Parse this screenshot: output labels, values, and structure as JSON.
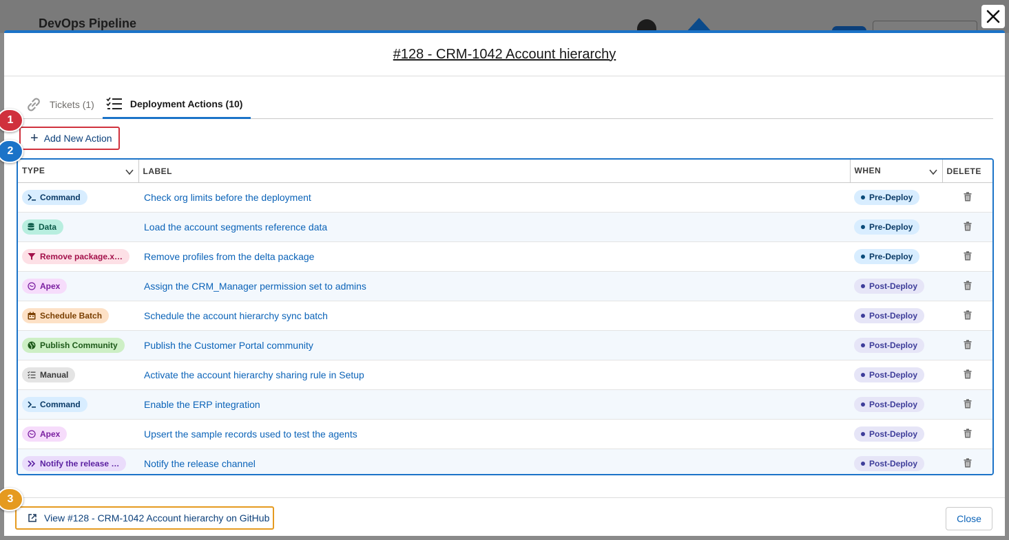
{
  "background": {
    "app_title": "DevOps Pipeline"
  },
  "modal": {
    "title": "#128 - CRM-1042 Account hierarchy",
    "tabs": [
      {
        "label": "Tickets (1)",
        "icon": "link-icon"
      },
      {
        "label": "Deployment Actions (10)",
        "icon": "checklist-icon",
        "active": true
      }
    ],
    "add_action_label": "Add New Action",
    "table": {
      "headers": {
        "type": "TYPE",
        "label": "LABEL",
        "when": "WHEN",
        "delete": "DELETE"
      },
      "rows": [
        {
          "type": "Command",
          "type_icon": "terminal-icon",
          "label": "Check org limits before the deployment",
          "when": "Pre-Deploy"
        },
        {
          "type": "Data",
          "type_icon": "database-icon",
          "label": "Load the account segments reference data",
          "when": "Pre-Deploy"
        },
        {
          "type": "Remove package.xml",
          "type_display": "Remove package.x…",
          "type_icon": "filter-icon",
          "label": "Remove profiles from the delta package",
          "when": "Pre-Deploy"
        },
        {
          "type": "Apex",
          "type_icon": "apex-icon",
          "label": "Assign the CRM_Manager permission set to admins",
          "when": "Post-Deploy"
        },
        {
          "type": "Schedule Batch",
          "type_icon": "calendar-icon",
          "label": "Schedule the account hierarchy sync batch",
          "when": "Post-Deploy"
        },
        {
          "type": "Publish Community",
          "type_icon": "globe-icon",
          "label": "Publish the Customer Portal community",
          "when": "Post-Deploy"
        },
        {
          "type": "Manual",
          "type_icon": "checklist-icon",
          "label": "Activate the account hierarchy sharing rule in Setup",
          "when": "Post-Deploy"
        },
        {
          "type": "Command",
          "type_icon": "terminal-icon",
          "label": "Enable the ERP integration",
          "when": "Post-Deploy"
        },
        {
          "type": "Apex",
          "type_icon": "apex-icon",
          "label": "Upsert the sample records used to test the agents",
          "when": "Post-Deploy"
        },
        {
          "type": "Notify the release channel",
          "type_display": "Notify the release …",
          "type_icon": "chevrons-right-icon",
          "label": "Notify the release channel",
          "when": "Post-Deploy"
        }
      ]
    },
    "footer": {
      "github_label": "View #128 - CRM-1042 Account hierarchy on GitHub",
      "close_label": "Close"
    }
  },
  "badges": [
    {
      "num": "1",
      "color": "#d0313d"
    },
    {
      "num": "2",
      "color": "#1b73c8"
    },
    {
      "num": "3",
      "color": "#e59a1f"
    }
  ],
  "type_colors": {
    "Command": {
      "bg": "#d8edff",
      "fg": "#0a3a66"
    },
    "Data": {
      "bg": "#b8eedf",
      "fg": "#0b5a48"
    },
    "Remove package.xml": {
      "bg": "#fde0e6",
      "fg": "#a3104a"
    },
    "Apex": {
      "bg": "#f6dcfb",
      "fg": "#7a1fa0"
    },
    "Schedule Batch": {
      "bg": "#fde1c6",
      "fg": "#7a3f00"
    },
    "Publish Community": {
      "bg": "#cdefc5",
      "fg": "#1e5a1a"
    },
    "Manual": {
      "bg": "#e4e4e4",
      "fg": "#3a3a3a"
    },
    "Notify the release channel": {
      "bg": "#eadcfb",
      "fg": "#5a1fa0"
    }
  }
}
